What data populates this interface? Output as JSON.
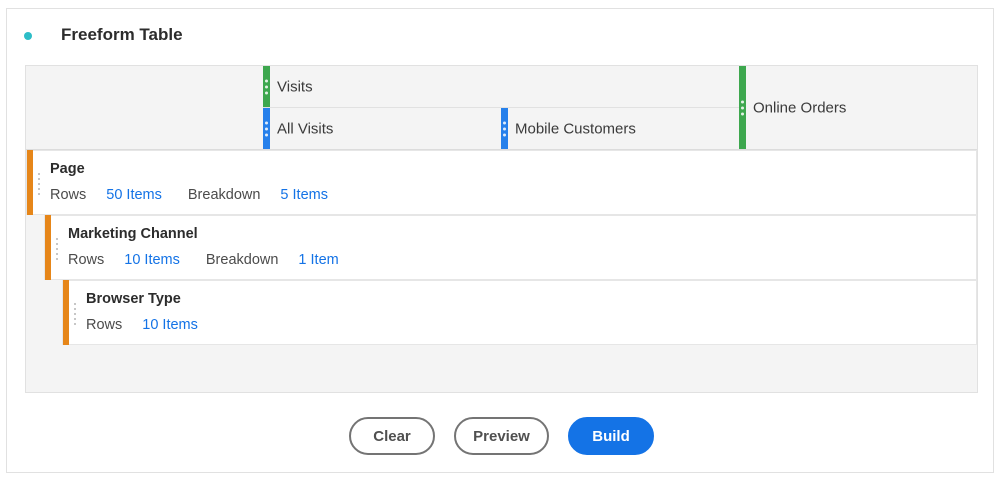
{
  "panel": {
    "title": "Freeform Table",
    "status_color": "#2dbdc7"
  },
  "columns": {
    "visits": "Visits",
    "all_visits": "All Visits",
    "mobile_customers": "Mobile Customers",
    "online_orders": "Online Orders"
  },
  "rows": [
    {
      "name": "Page",
      "rows_label": "Rows",
      "rows_value": "50 Items",
      "breakdown_label": "Breakdown",
      "breakdown_value": "5 Items"
    },
    {
      "name": "Marketing Channel",
      "rows_label": "Rows",
      "rows_value": "10 Items",
      "breakdown_label": "Breakdown",
      "breakdown_value": "1 Item"
    },
    {
      "name": "Browser Type",
      "rows_label": "Rows",
      "rows_value": "10 Items"
    }
  ],
  "actions": {
    "clear": "Clear",
    "preview": "Preview",
    "build": "Build"
  },
  "colors": {
    "metric_bar": "#3da74e",
    "segment_bar": "#2680eb",
    "dimension_bar": "#e68619",
    "link": "#1473e6",
    "primary_button": "#1473e6"
  }
}
